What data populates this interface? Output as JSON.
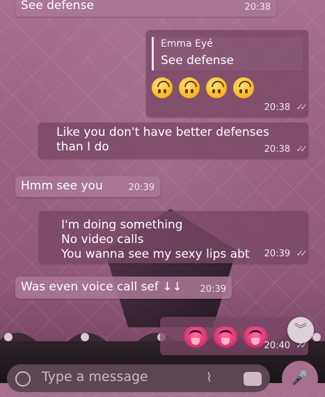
{
  "messages": [
    {
      "text": "See defense",
      "time": "20:38"
    },
    {
      "quote_name": "Emma Eyé",
      "quote_text": "See defense",
      "time": "20:38",
      "emoji_count": 4
    },
    {
      "text": "Like you don't have better defenses\nthan I do",
      "time": "20:38"
    },
    {
      "text": "Hmm see you",
      "time": "20:39"
    },
    {
      "text": "I'm doing something\nNo video calls\nYou wanna see my sexy lips abt",
      "time": "20:39"
    },
    {
      "text": "Was even voice call sef ↓↓",
      "time": "20:39"
    },
    {
      "time": "20:40",
      "emoji_count": 3
    }
  ],
  "input": {
    "placeholder": "Type a message"
  },
  "icons": {
    "check": "double-check-icon",
    "scroll": "chevron-down-double-icon",
    "emoji": "emoji-icon",
    "attach": "paperclip-icon",
    "camera": "camera-icon",
    "mic": "microphone-icon"
  }
}
